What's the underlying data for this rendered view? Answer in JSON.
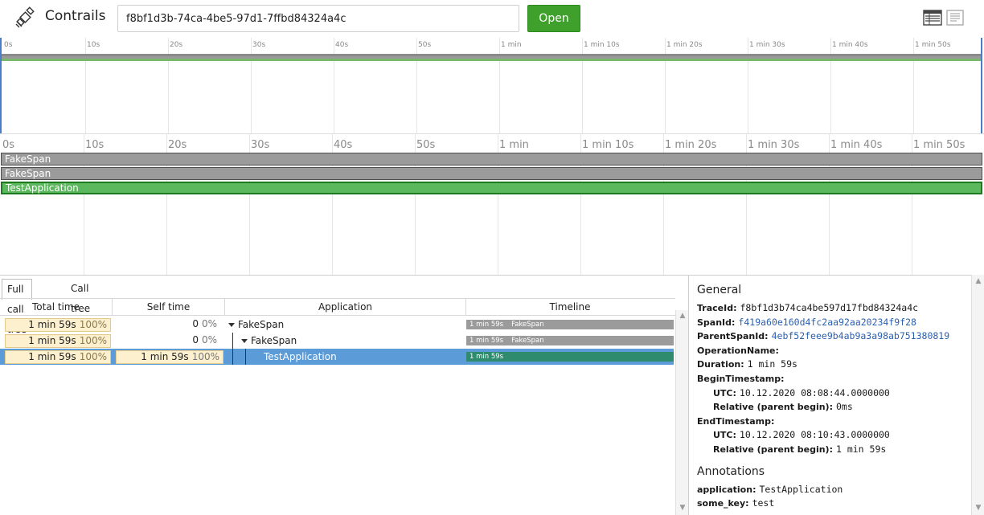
{
  "header": {
    "app_title": "Contrails",
    "trace_id_value": "f8bf1d3b-74ca-4be5-97d1-7ffbd84324a4c",
    "open_label": "Open",
    "icons": [
      "table-view-icon",
      "document-view-icon"
    ]
  },
  "overview": {
    "ticks": [
      "0s",
      "10s",
      "20s",
      "30s",
      "40s",
      "50s",
      "1 min",
      "1 min 10s",
      "1 min 20s",
      "1 min 30s",
      "1 min 40s",
      "1 min 50s"
    ],
    "band_colors": [
      "#8a8a8a",
      "#9a9a9a",
      "#7ab86e"
    ]
  },
  "timeline": {
    "ticks": [
      "0s",
      "10s",
      "20s",
      "30s",
      "40s",
      "50s",
      "1 min",
      "1 min 10s",
      "1 min 20s",
      "1 min 30s",
      "1 min 40s",
      "1 min 50s"
    ],
    "spans": [
      {
        "label": "FakeSpan",
        "kind": "span"
      },
      {
        "label": "FakeSpan",
        "kind": "span"
      },
      {
        "label": "TestApplication",
        "kind": "app"
      }
    ]
  },
  "tabs": [
    {
      "label": "Full call tree",
      "active": true
    },
    {
      "label": "Call tree",
      "active": false
    }
  ],
  "grid": {
    "columns": [
      "Total time",
      "Self time",
      "Application",
      "Timeline"
    ],
    "rows": [
      {
        "total": "1 min 59s",
        "total_pct": "100%",
        "self": "0",
        "self_pct": "0%",
        "app": "FakeSpan",
        "tl_time": "1 min 59s",
        "tl_name": "FakeSpan",
        "selected": false
      },
      {
        "total": "1 min 59s",
        "total_pct": "100%",
        "self": "0",
        "self_pct": "0%",
        "app": "FakeSpan",
        "tl_time": "1 min 59s",
        "tl_name": "FakeSpan",
        "selected": false
      },
      {
        "total": "1 min 59s",
        "total_pct": "100%",
        "self": "1 min 59s",
        "self_pct": "100%",
        "app": "TestApplication",
        "tl_time": "1 min 59s",
        "tl_name": "",
        "selected": true
      }
    ]
  },
  "details": {
    "general_title": "General",
    "trace_id_key": "TraceId:",
    "trace_id": "f8bf1d3b74ca4be597d17fbd84324a4c",
    "span_id_key": "SpanId:",
    "span_id": "f419a60e160d4fc2aa92aa20234f9f28",
    "parent_span_id_key": "ParentSpanId:",
    "parent_span_id": "4ebf52feee9b4ab9a3a98ab751380819",
    "operation_name_key": "OperationName:",
    "duration_key": "Duration:",
    "duration": "1 min 59s",
    "begin_key": "BeginTimestamp:",
    "utc_key": "UTC:",
    "begin_utc": "10.12.2020 08:08:44.0000000",
    "relative_key": "Relative (parent begin):",
    "begin_relative": "0ms",
    "end_key": "EndTimestamp:",
    "end_utc": "10.12.2020 08:10:43.0000000",
    "end_relative": "1 min 59s",
    "annotations_title": "Annotations",
    "ann_app_key": "application:",
    "ann_app_val": "TestApplication",
    "ann_some_key": "some_key:",
    "ann_some_val": "test"
  }
}
